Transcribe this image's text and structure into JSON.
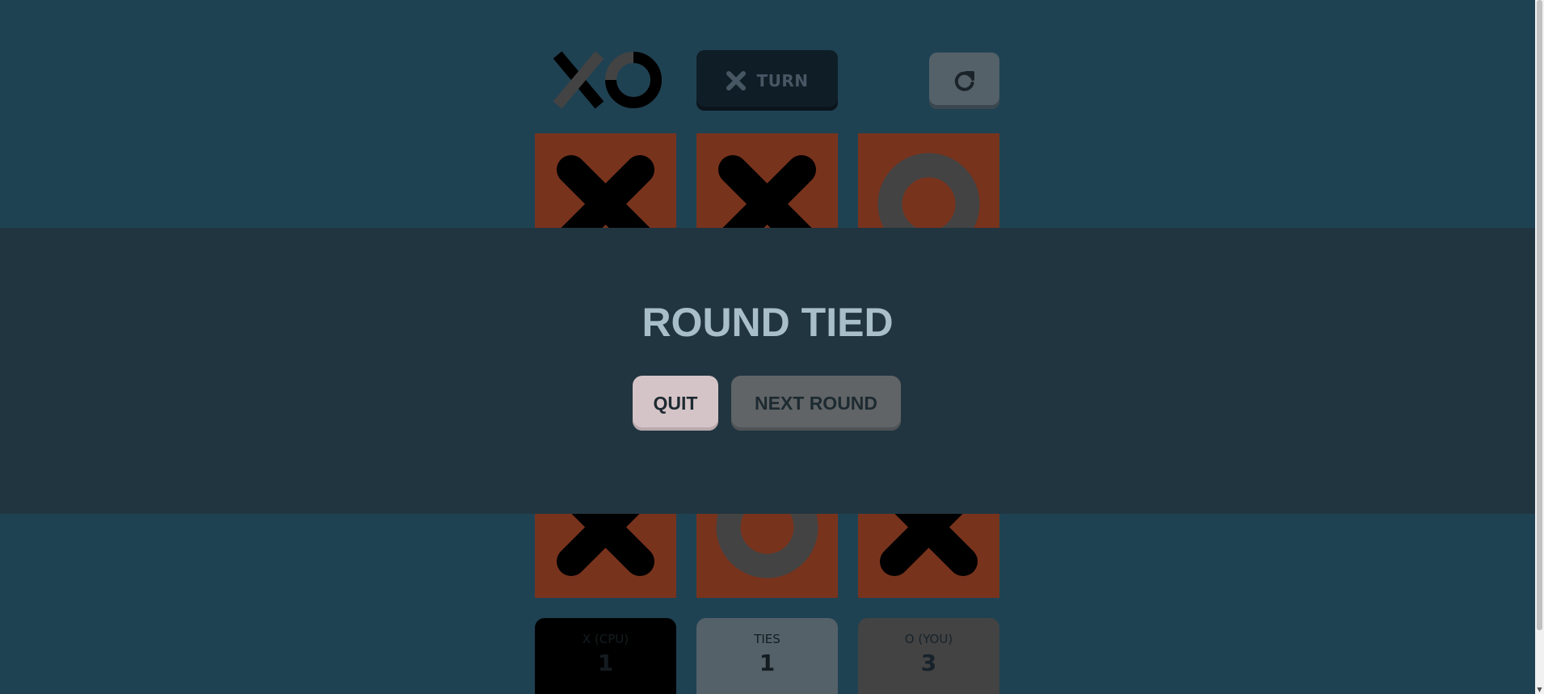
{
  "header": {
    "logo_icon": "xo-logo-icon",
    "turn": {
      "mark_icon": "x-mark-icon",
      "label": "TURN"
    },
    "restart_icon": "restart-icon"
  },
  "board": {
    "cells": [
      "X",
      "X",
      "O",
      "",
      "",
      "",
      "X",
      "O",
      "X"
    ],
    "hidden_behind_overlay": "middle row"
  },
  "modal": {
    "title": "ROUND TIED",
    "quit_label": "QUIT",
    "next_label": "NEXT ROUND"
  },
  "scores": {
    "x": {
      "label": "X (CPU)",
      "value": "1"
    },
    "ties": {
      "label": "TIES",
      "value": "1"
    },
    "o": {
      "label": "O (YOU)",
      "value": "3"
    }
  },
  "colors": {
    "background": "#1f4253",
    "cell": "#78331d",
    "x_mark": "#000000",
    "o_mark": "#434343",
    "overlay": "#213540",
    "title": "#a8bfc9",
    "quit_button": "#d5c4c7",
    "next_button": "#606466"
  }
}
